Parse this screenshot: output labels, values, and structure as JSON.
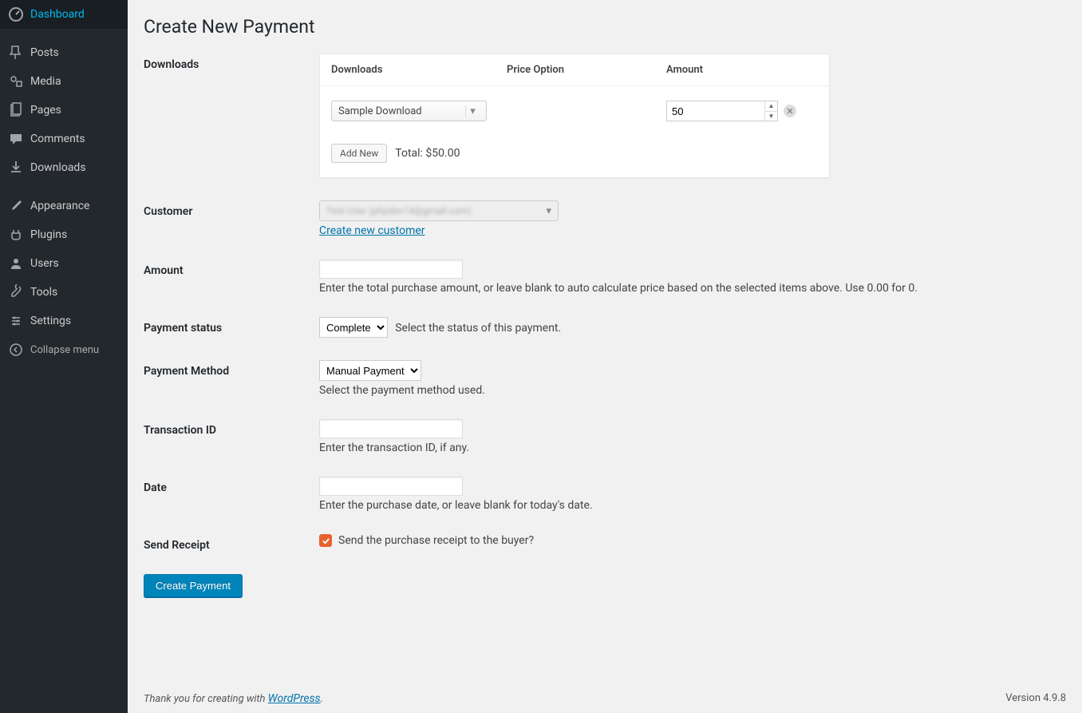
{
  "sidebar": {
    "items": [
      {
        "label": "Dashboard",
        "icon": "dashboard"
      },
      {
        "label": "Posts",
        "icon": "pin"
      },
      {
        "label": "Media",
        "icon": "media"
      },
      {
        "label": "Pages",
        "icon": "page"
      },
      {
        "label": "Comments",
        "icon": "comment"
      },
      {
        "label": "Downloads",
        "icon": "download"
      },
      {
        "label": "Appearance",
        "icon": "brush"
      },
      {
        "label": "Plugins",
        "icon": "plugin"
      },
      {
        "label": "Users",
        "icon": "user"
      },
      {
        "label": "Tools",
        "icon": "wrench"
      },
      {
        "label": "Settings",
        "icon": "settings"
      }
    ],
    "collapse": "Collapse menu"
  },
  "page": {
    "title": "Create New Payment"
  },
  "downloads": {
    "label": "Downloads",
    "headers": {
      "c1": "Downloads",
      "c2": "Price Option",
      "c3": "Amount"
    },
    "rows": [
      {
        "product": "Sample Download",
        "price_option": "",
        "amount": "50"
      }
    ],
    "add_new": "Add New",
    "total_label": "Total: $50.00"
  },
  "customer": {
    "label": "Customer",
    "selected": "Test User (phpdev14@gmail.com)",
    "create_link": "Create new customer"
  },
  "amount": {
    "label": "Amount",
    "value": "",
    "help": "Enter the total purchase amount, or leave blank to auto calculate price based on the selected items above. Use 0.00 for 0."
  },
  "status": {
    "label": "Payment status",
    "value": "Complete",
    "help": "Select the status of this payment."
  },
  "method": {
    "label": "Payment Method",
    "value": "Manual Payment",
    "help": "Select the payment method used."
  },
  "txn": {
    "label": "Transaction ID",
    "value": "",
    "help": "Enter the transaction ID, if any."
  },
  "date": {
    "label": "Date",
    "value": "",
    "help": "Enter the purchase date, or leave blank for today's date."
  },
  "receipt": {
    "label": "Send Receipt",
    "checked": true,
    "text": "Send the purchase receipt to the buyer?"
  },
  "submit": {
    "label": "Create Payment"
  },
  "footer": {
    "thanks_prefix": "Thank you for creating with ",
    "wp_link": "WordPress",
    "thanks_suffix": ".",
    "version": "Version 4.9.8"
  }
}
